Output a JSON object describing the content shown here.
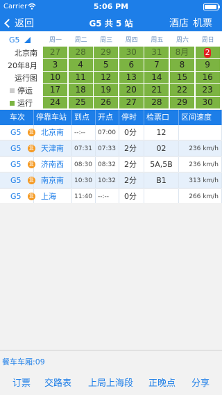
{
  "status": {
    "carrier": "Carrier",
    "time": "5:06 PM"
  },
  "nav": {
    "back": "返回",
    "title": "G5 共 5 站",
    "hotel": "酒店",
    "flight": "机票"
  },
  "calendar": {
    "train": "G5",
    "station": "北京南",
    "month": "20年8月",
    "chart_label": "运行图",
    "legend_stop": "停运",
    "legend_run": "运行",
    "legend_stop_color": "#cccccc",
    "legend_run_color": "#7cb442",
    "weekdays": [
      "周一",
      "周二",
      "周三",
      "周四",
      "周五",
      "周六",
      "周日"
    ],
    "weeks": [
      [
        "27",
        "28",
        "29",
        "30",
        "31",
        "8月",
        "2"
      ],
      [
        "3",
        "4",
        "5",
        "6",
        "7",
        "8",
        "9"
      ],
      [
        "10",
        "11",
        "12",
        "13",
        "14",
        "15",
        "16"
      ],
      [
        "17",
        "18",
        "19",
        "20",
        "21",
        "22",
        "23"
      ],
      [
        "24",
        "25",
        "26",
        "27",
        "28",
        "29",
        "30"
      ]
    ]
  },
  "table": {
    "headers": [
      "车次",
      "停靠车站",
      "到点",
      "开点",
      "停时",
      "检票口",
      "区间速度"
    ],
    "rows": [
      {
        "train": "G5",
        "station": "北京南",
        "arrive": "--:--",
        "depart": "07:00",
        "stop": "0分",
        "gate": "12",
        "speed": ""
      },
      {
        "train": "G5",
        "station": "天津南",
        "arrive": "07:31",
        "depart": "07:33",
        "stop": "2分",
        "gate": "02",
        "speed": "236 km/h"
      },
      {
        "train": "G5",
        "station": "济南西",
        "arrive": "08:30",
        "depart": "08:32",
        "stop": "2分",
        "gate": "5A,5B",
        "speed": "236 km/h"
      },
      {
        "train": "G5",
        "station": "南京南",
        "arrive": "10:30",
        "depart": "10:32",
        "stop": "2分",
        "gate": "B1",
        "speed": "313 km/h"
      },
      {
        "train": "G5",
        "station": "上海",
        "arrive": "11:40",
        "depart": "--:--",
        "stop": "0分",
        "gate": "",
        "speed": "266 km/h"
      }
    ]
  },
  "footer": {
    "car_info": "餐车车厢:09",
    "tools": [
      "订票",
      "交路表",
      "上局上海段",
      "正晚点",
      "分享"
    ]
  },
  "colors": {
    "accent": "#1d7ee8",
    "calendar_green": "#7cb442",
    "highlight_red": "#e02020",
    "badge_orange": "#f59a23"
  }
}
